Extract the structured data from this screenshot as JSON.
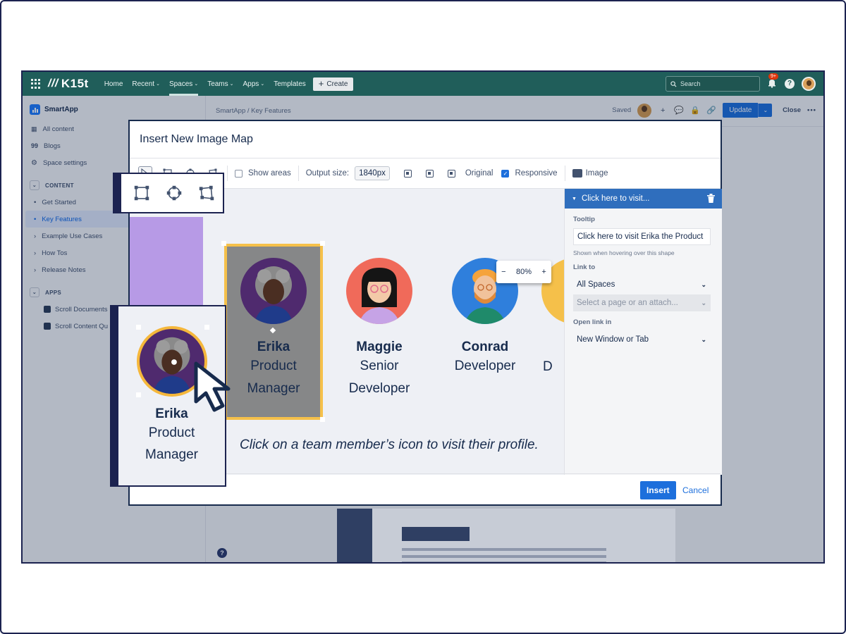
{
  "app": {
    "logo_text": "K15t",
    "nav": [
      {
        "label": "Home",
        "caret": ""
      },
      {
        "label": "Recent",
        "caret": "⌄"
      },
      {
        "label": "Spaces",
        "caret": "⌄"
      },
      {
        "label": "Teams",
        "caret": "⌄"
      },
      {
        "label": "Apps",
        "caret": "⌄"
      },
      {
        "label": "Templates",
        "caret": ""
      }
    ],
    "create_label": "Create",
    "search_placeholder": "Search",
    "notification_badge": "9+",
    "help_glyph": "?"
  },
  "sidebar": {
    "space_name": "SmartApp",
    "links": [
      "All content",
      "Blogs",
      "Space settings"
    ],
    "content_section": "CONTENT",
    "tree": [
      {
        "label": "Get Started",
        "marker": "•"
      },
      {
        "label": "Key Features",
        "marker": "•"
      },
      {
        "label": "Example Use Cases",
        "marker": "›"
      },
      {
        "label": "How Tos",
        "marker": "›"
      },
      {
        "label": "Release Notes",
        "marker": "›"
      }
    ],
    "apps_section": "APPS",
    "apps": [
      "Scroll Documents",
      "Scroll Content Qu"
    ]
  },
  "content": {
    "breadcrumb": "SmartApp  /  Key Features",
    "saved_label": "Saved",
    "update_label": "Update",
    "close_label": "Close",
    "more_label": "•••"
  },
  "modal": {
    "title": "Insert New Image Map",
    "toolbar": {
      "show_areas_label": "Show areas",
      "output_size_label": "Output size:",
      "output_size_value": "1840px",
      "original_label": "Original",
      "responsive_label": "Responsive",
      "image_label": "Image",
      "show_areas_checked": false,
      "responsive_checked": true
    },
    "zoom": {
      "minus": "−",
      "value": "80%",
      "plus": "+"
    },
    "members": [
      {
        "name": "Erika",
        "role_line1": "Product",
        "role_line2": "Manager"
      },
      {
        "name": "Maggie",
        "role_line1": "Senior",
        "role_line2": "Developer"
      },
      {
        "name": "Conrad",
        "role_line1": "Developer",
        "role_line2": ""
      },
      {
        "name": "",
        "role_line1": "D",
        "role_line2": ""
      }
    ],
    "caption": "Click on a team member’s icon to visit their profile.",
    "panel": {
      "header": "Click here to visit...",
      "tooltip_label": "Tooltip",
      "tooltip_value": "Click here to visit Erika the Product",
      "tooltip_hint": "Shown when hovering over this shape",
      "link_to_label": "Link to",
      "link_to_value": "All Spaces",
      "page_placeholder": "Select a page or an attach...",
      "open_link_label": "Open link in",
      "open_link_value": "New Window or Tab"
    },
    "insert_label": "Insert",
    "cancel_label": "Cancel"
  },
  "callout": {
    "name": "Erika",
    "role_line1": "Product",
    "role_line2": "Manager"
  },
  "colors": {
    "nav_bg": "#205e5a",
    "primary_blue": "#1d6fdc",
    "panel_header": "#2f6ebd",
    "selection_border": "#f5c04a",
    "frame": "#1c2350"
  },
  "icons": [
    "grid-icon",
    "search-icon",
    "bell-icon",
    "help-icon",
    "trash-icon",
    "select-tool-icon",
    "rectangle-tool-icon",
    "circle-tool-icon",
    "polygon-tool-icon",
    "image-icon",
    "pointer-cursor-icon"
  ]
}
